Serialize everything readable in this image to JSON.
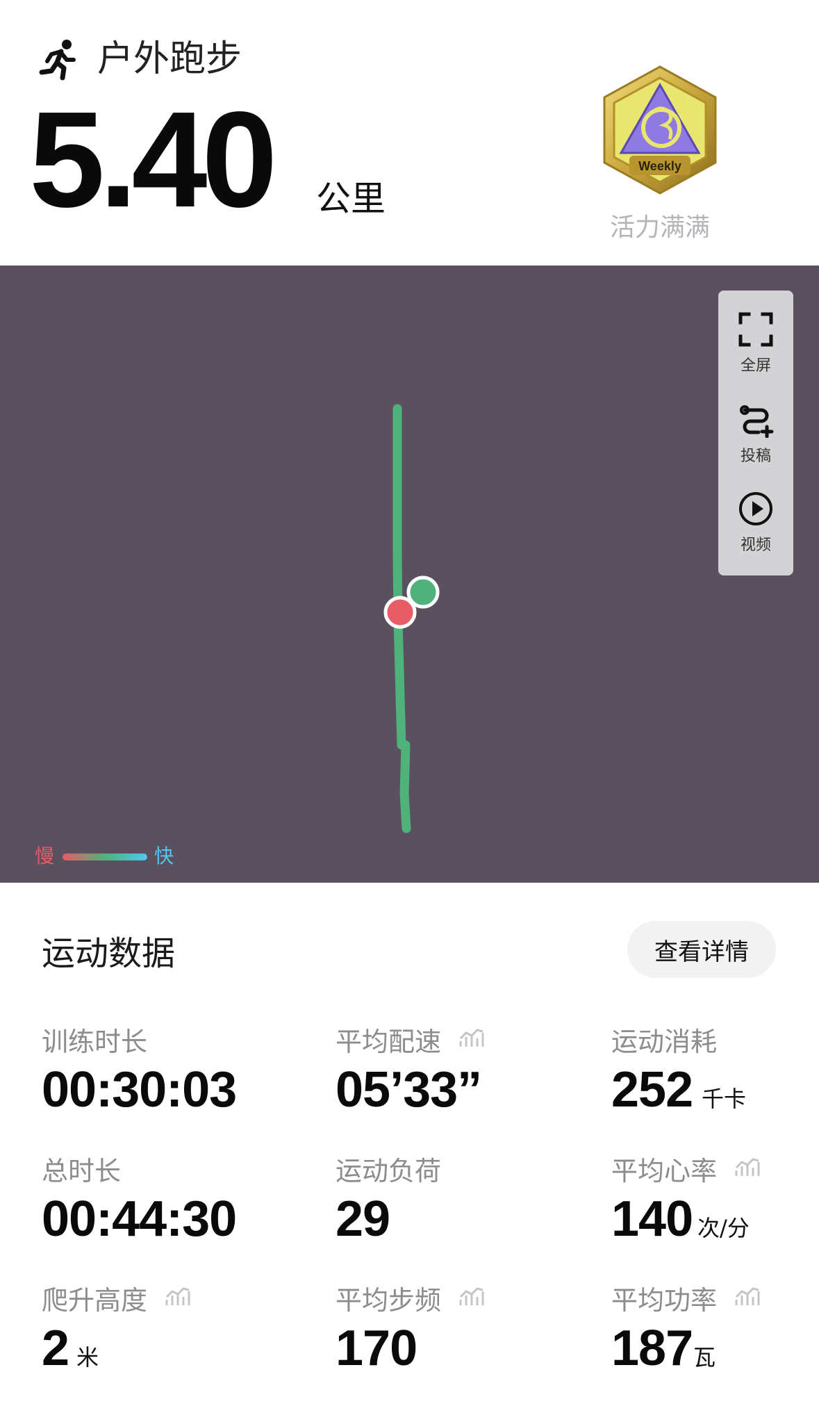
{
  "header": {
    "activity_type": "户外跑步",
    "distance_value": "5.40",
    "distance_unit": "公里",
    "badge": {
      "text": "Weekly",
      "name": "活力满满"
    }
  },
  "map": {
    "tools": [
      {
        "label": "全屏",
        "icon": "fullscreen-icon"
      },
      {
        "label": "投稿",
        "icon": "route-add-icon"
      },
      {
        "label": "视频",
        "icon": "play-icon"
      }
    ],
    "legend": {
      "slow": "慢",
      "fast": "快"
    },
    "colors": {
      "background": "#5a5060",
      "track": "#4fb27a",
      "start": "#4fb27a",
      "end": "#e85c66"
    }
  },
  "stats": {
    "title": "运动数据",
    "detail_button": "查看详情",
    "items": [
      {
        "label": "训练时长",
        "value": "00:30:03",
        "unit": ""
      },
      {
        "label": "平均配速",
        "value": "05’33”",
        "unit": ""
      },
      {
        "label": "运动消耗",
        "value": "252",
        "unit": "千卡"
      },
      {
        "label": "总时长",
        "value": "00:44:30",
        "unit": ""
      },
      {
        "label": "运动负荷",
        "value": "29",
        "unit": ""
      },
      {
        "label": "平均心率",
        "value": "140",
        "unit": "次/分"
      },
      {
        "label": "爬升高度",
        "value": "2",
        "unit": "米"
      },
      {
        "label": "平均步频",
        "value": "170",
        "unit": ""
      },
      {
        "label": "平均功率",
        "value": "187",
        "unit": "瓦"
      }
    ]
  }
}
